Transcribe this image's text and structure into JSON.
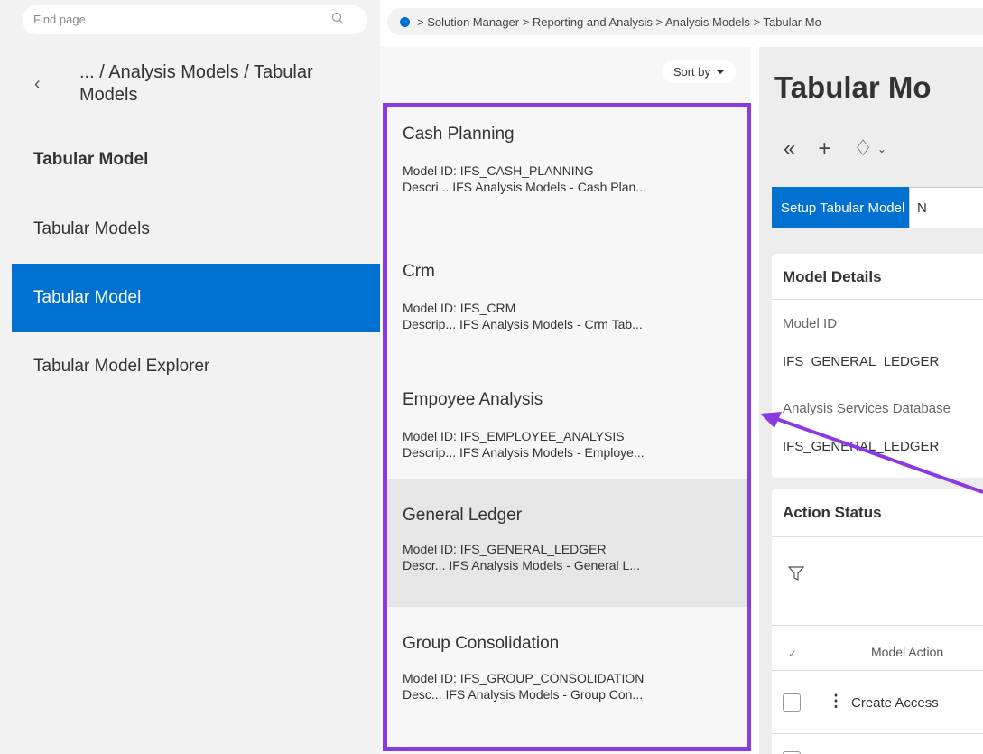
{
  "search": {
    "placeholder": "Find page"
  },
  "left_nav": {
    "crumb": "... / Analysis Models / Tabular Models",
    "heading": "Tabular Model",
    "items": [
      {
        "label": "Tabular Models"
      },
      {
        "label": "Tabular Model"
      },
      {
        "label": "Tabular Model Explorer"
      }
    ]
  },
  "breadcrumb": {
    "text": "> Solution Manager > Reporting and Analysis > Analysis Models > Tabular Mo"
  },
  "list": {
    "sort_label": "Sort by",
    "cards": [
      {
        "title": "Cash Planning",
        "line1": "Model ID:  IFS_CASH_PLANNING",
        "line2": "Descri...  IFS Analysis Models - Cash Plan..."
      },
      {
        "title": "Crm",
        "line1": "Model ID:  IFS_CRM",
        "line2": "Descrip...  IFS Analysis Models - Crm Tab..."
      },
      {
        "title": "Empoyee Analysis",
        "line1": "Model ID:  IFS_EMPLOYEE_ANALYSIS",
        "line2": "Descrip...  IFS Analysis Models - Employe..."
      },
      {
        "title": "General Ledger",
        "line1": "Model ID:  IFS_GENERAL_LEDGER",
        "line2": "Descr...  IFS Analysis Models - General L..."
      },
      {
        "title": "Group Consolidation",
        "line1": "Model ID:  IFS_GROUP_CONSOLIDATION",
        "line2": "Desc...  IFS Analysis Models - Group Con..."
      }
    ]
  },
  "detail": {
    "title": "Tabular Mo",
    "tab_active": "Setup Tabular Model",
    "tab_next": "N",
    "model_details": {
      "heading": "Model Details",
      "model_id_label": "Model ID",
      "model_id_value": "IFS_GENERAL_LEDGER",
      "db_label": "Analysis Services Database",
      "db_value": "IFS_GENERAL_LEDGER"
    },
    "action_status": {
      "heading": "Action Status",
      "col_model_action": "Model Action",
      "row1_action": "Create Access"
    }
  },
  "colors": {
    "accent": "#0071d1",
    "highlight": "#8a3ae0"
  }
}
